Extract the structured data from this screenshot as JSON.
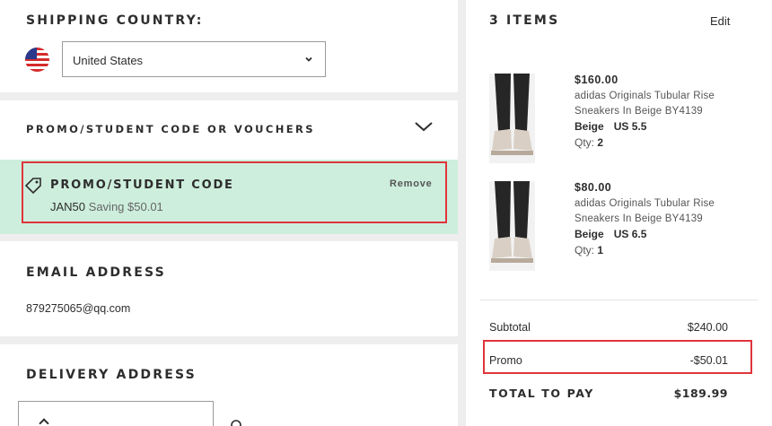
{
  "shipping": {
    "title": "SHIPPING COUNTRY:",
    "country": "United States",
    "flag_icon": "us-flag-icon"
  },
  "promo": {
    "section_title": "PROMO/STUDENT CODE OR VOUCHERS",
    "applied_title": "PROMO/STUDENT CODE",
    "code": "JAN50",
    "saving_text": "Saving $50.01",
    "remove_label": "Remove",
    "applied_bg": "#cdeedd",
    "highlight_color": "#e0343b"
  },
  "email": {
    "title": "EMAIL ADDRESS",
    "value": "879275065@qq.com"
  },
  "delivery": {
    "title": "DELIVERY ADDRESS"
  },
  "summary": {
    "items_title": "3 ITEMS",
    "edit_label": "Edit",
    "items": [
      {
        "price": "$160.00",
        "name": "adidas Originals Tubular Rise Sneakers In Beige BY4139",
        "color": "Beige",
        "size": "US 5.5",
        "qty_label": "Qty:",
        "qty": "2"
      },
      {
        "price": "$80.00",
        "name": "adidas Originals Tubular Rise Sneakers In Beige BY4139",
        "color": "Beige",
        "size": "US 6.5",
        "qty_label": "Qty:",
        "qty": "1"
      }
    ],
    "subtotal_label": "Subtotal",
    "subtotal": "$240.00",
    "promo_label": "Promo",
    "promo_value": "-$50.01",
    "total_label": "TOTAL TO PAY",
    "total": "$189.99"
  }
}
